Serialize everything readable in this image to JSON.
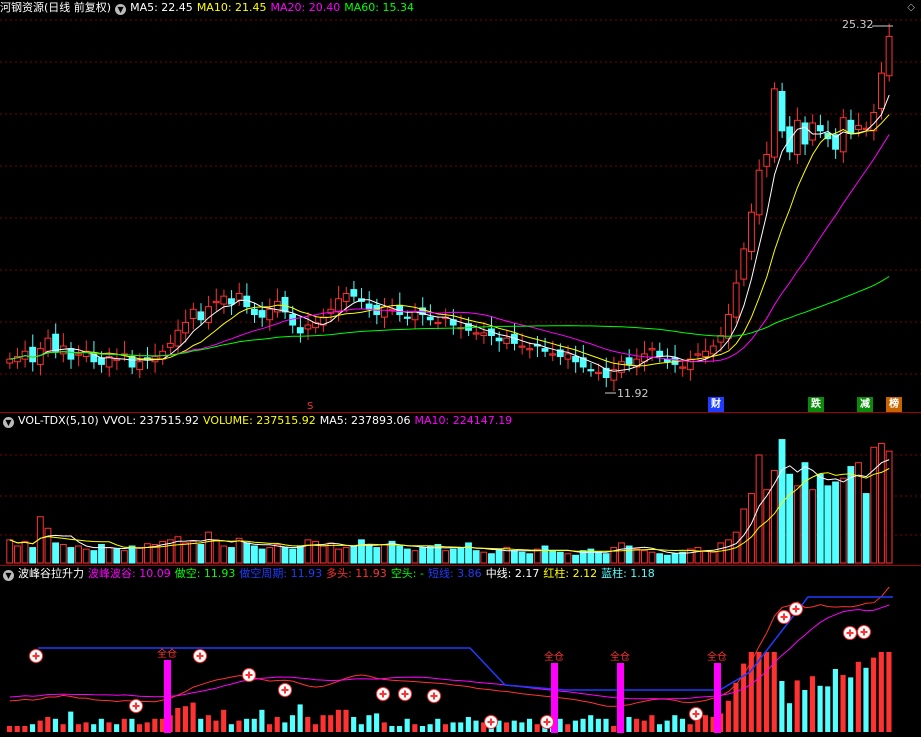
{
  "colors": {
    "up": "#ff3232",
    "down": "#54ffff",
    "ma5": "#ffffff",
    "ma10": "#ffff00",
    "ma20": "#ff00ff",
    "ma60": "#00ff00",
    "blue": "#1e3cff",
    "grid": "#7a0000"
  },
  "main": {
    "title": "河钢资源(日线 前复权)",
    "ma5": "MA5: 22.45",
    "ma10": "MA10: 21.45",
    "ma20": "MA20: 20.40",
    "ma60": "MA60: 15.34",
    "high_label": "25.32",
    "low_label": "11.92",
    "corner_icon": "diamond-icon",
    "markers": [
      "财",
      "跌",
      "减",
      "榜"
    ]
  },
  "vol": {
    "title": "VOL-TDX(5,10)",
    "vvol": "VVOL: 237515.92",
    "volume": "VOLUME: 237515.92",
    "ma5": "MA5: 237893.06",
    "ma10": "MA10: 224147.19"
  },
  "ind": {
    "title": "波峰谷拉升力",
    "a": "波峰波谷: 10.09",
    "b": "做空: 11.93",
    "c": "做空周期: 11.93",
    "d": "多头: 11.93",
    "e": "空头: -",
    "f": "短线: 3.86",
    "g": "中线: 2.17",
    "h": "红柱: 2.12",
    "i": "蓝柱: 1.18",
    "marker": "全仓"
  },
  "chart_data": {
    "type": "candlestick",
    "price_range": [
      11.5,
      25.6
    ],
    "closes": [
      12.6,
      12.7,
      12.9,
      12.5,
      13.0,
      13.4,
      12.9,
      13.1,
      12.6,
      12.8,
      12.9,
      12.5,
      12.4,
      12.7,
      12.6,
      12.8,
      12.3,
      12.5,
      12.6,
      12.7,
      12.9,
      13.2,
      13.7,
      14.0,
      14.5,
      14.1,
      14.6,
      14.8,
      15.0,
      14.7,
      15.1,
      14.6,
      14.3,
      14.2,
      14.5,
      14.8,
      14.4,
      13.9,
      13.6,
      13.9,
      14.0,
      14.2,
      14.5,
      14.9,
      15.1,
      15.0,
      14.8,
      14.5,
      14.3,
      14.6,
      14.5,
      14.3,
      14.2,
      14.4,
      14.3,
      14.1,
      14.0,
      14.2,
      13.9,
      13.8,
      13.7,
      13.6,
      13.6,
      13.5,
      13.3,
      13.4,
      13.2,
      13.1,
      13.0,
      13.1,
      12.9,
      12.8,
      12.7,
      12.8,
      12.5,
      12.3,
      12.2,
      12.1,
      11.9,
      12.2,
      12.5,
      12.4,
      12.6,
      12.8,
      13.0,
      12.7,
      12.5,
      12.4,
      12.3,
      12.6,
      12.8,
      12.9,
      13.1,
      13.5,
      14.3,
      15.5,
      16.8,
      18.2,
      19.8,
      20.4,
      22.9,
      21.3,
      20.5,
      21.7,
      20.8,
      21.6,
      21.3,
      21.0,
      20.6,
      21.8,
      21.2,
      21.5,
      21.4,
      22.0,
      23.5,
      24.9
    ],
    "volumes": [
      30,
      22,
      28,
      20,
      60,
      45,
      26,
      24,
      20,
      22,
      18,
      16,
      24,
      20,
      18,
      16,
      22,
      20,
      25,
      24,
      28,
      30,
      34,
      26,
      28,
      24,
      40,
      30,
      22,
      20,
      32,
      26,
      22,
      18,
      20,
      24,
      20,
      18,
      22,
      30,
      28,
      22,
      26,
      18,
      20,
      22,
      30,
      24,
      20,
      24,
      28,
      22,
      18,
      16,
      20,
      22,
      24,
      16,
      18,
      20,
      26,
      16,
      14,
      12,
      18,
      20,
      16,
      14,
      12,
      18,
      22,
      16,
      14,
      12,
      10,
      16,
      18,
      14,
      12,
      20,
      26,
      22,
      18,
      16,
      14,
      12,
      10,
      12,
      14,
      18,
      20,
      16,
      14,
      26,
      30,
      40,
      70,
      90,
      140,
      95,
      120,
      160,
      115,
      100,
      130,
      95,
      115,
      100,
      105,
      110,
      125,
      130,
      90,
      150,
      155,
      145
    ],
    "ma5_last": 22.45,
    "ma10_last": 21.45,
    "ma20_last": 20.4,
    "ma60_last": 15.34,
    "volume_last": 237515.92,
    "vol_ma5": 237893.06,
    "vol_ma10": 224147.19
  }
}
